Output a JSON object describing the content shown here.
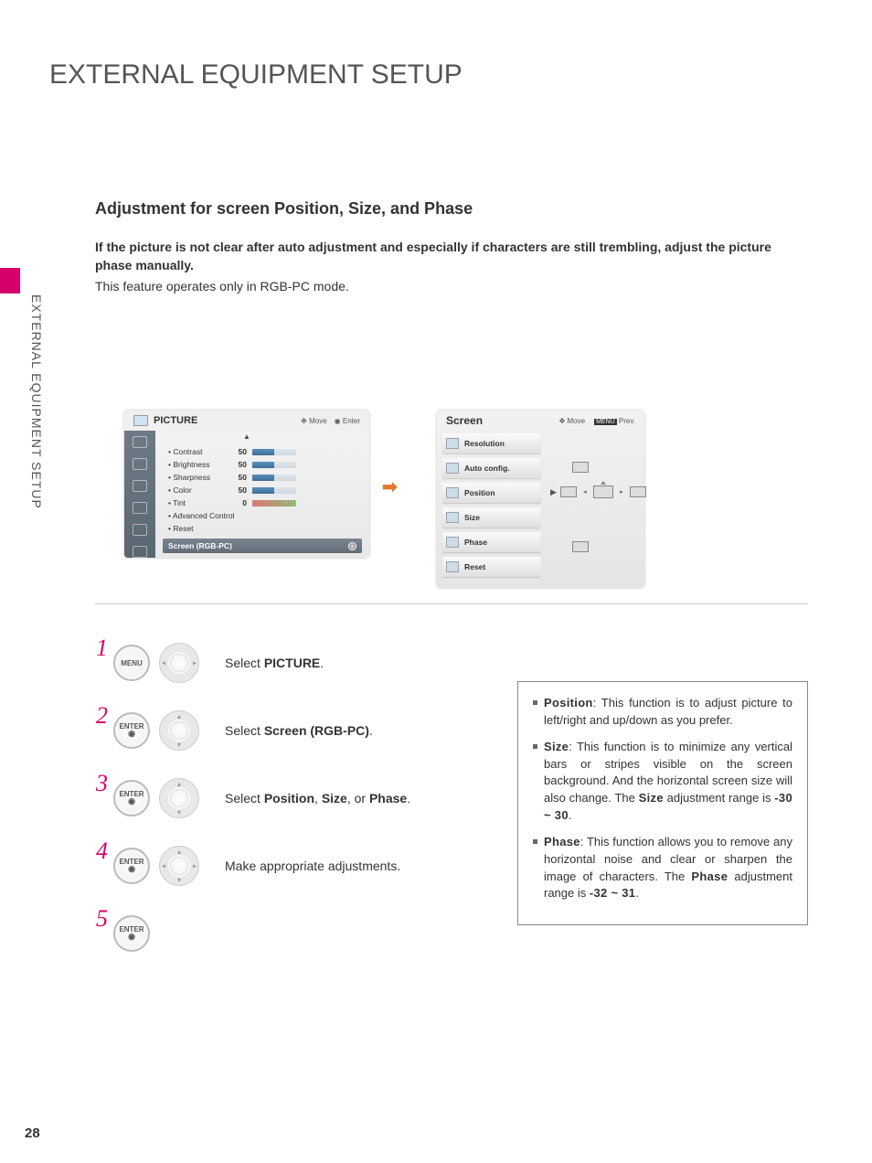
{
  "page_number": "28",
  "side_label": "EXTERNAL EQUIPMENT SETUP",
  "title": "EXTERNAL EQUIPMENT SETUP",
  "subtitle": "Adjustment for screen Position, Size, and Phase",
  "intro_line1": "If the picture is not clear after auto adjustment and especially if characters are still trembling, adjust the picture phase manually.",
  "intro_line2": "This feature operates only in RGB-PC mode.",
  "osd_picture": {
    "header": "PICTURE",
    "hint_move": "Move",
    "hint_enter": "Enter",
    "items": [
      {
        "label": "• Contrast",
        "value": "50"
      },
      {
        "label": "• Brightness",
        "value": "50"
      },
      {
        "label": "• Sharpness",
        "value": "50"
      },
      {
        "label": "• Color",
        "value": "50"
      },
      {
        "label": "• Tint",
        "value": "0"
      }
    ],
    "adv": "• Advanced Control",
    "reset": "• Reset",
    "screen_rgb": "Screen (RGB-PC)"
  },
  "osd_screen": {
    "header": "Screen",
    "hint_move": "Move",
    "hint_prev": "Prev.",
    "menu_tag": "MENU",
    "items": [
      "Resolution",
      "Auto config.",
      "Position",
      "Size",
      "Phase",
      "Reset"
    ]
  },
  "steps": {
    "menu_btn": "MENU",
    "enter_btn": "ENTER",
    "n1": "1",
    "n2": "2",
    "n3": "3",
    "n4": "4",
    "n5": "5",
    "s1_pre": "Select ",
    "s1_b": "PICTURE",
    "s1_post": ".",
    "s2_pre": "Select ",
    "s2_b": "Screen (RGB-PC)",
    "s2_post": ".",
    "s3_pre": "Select ",
    "s3_b1": "Position",
    "s3_mid1": ", ",
    "s3_b2": "Size",
    "s3_mid2": ", or ",
    "s3_b3": "Phase",
    "s3_post": ".",
    "s4": "Make appropriate adjustments."
  },
  "info": {
    "pos_b": "Position",
    "pos_txt": ": This function is to adjust picture to left/right and up/down as you prefer.",
    "size_b": "Size",
    "size_txt_a": ": This function is to minimize any vertical bars or stripes visible on the screen background. And the horizontal screen size will also change. The ",
    "size_txt_b": "Size",
    "size_txt_c": " adjustment range is ",
    "size_range": "-30 ~ 30",
    "phase_b": "Phase",
    "phase_txt_a": ": This function allows you to remove any horizontal noise and clear or sharpen the image of characters. The ",
    "phase_txt_b": "Phase",
    "phase_txt_c": " adjustment range is ",
    "phase_range": "-32 ~ 31"
  }
}
